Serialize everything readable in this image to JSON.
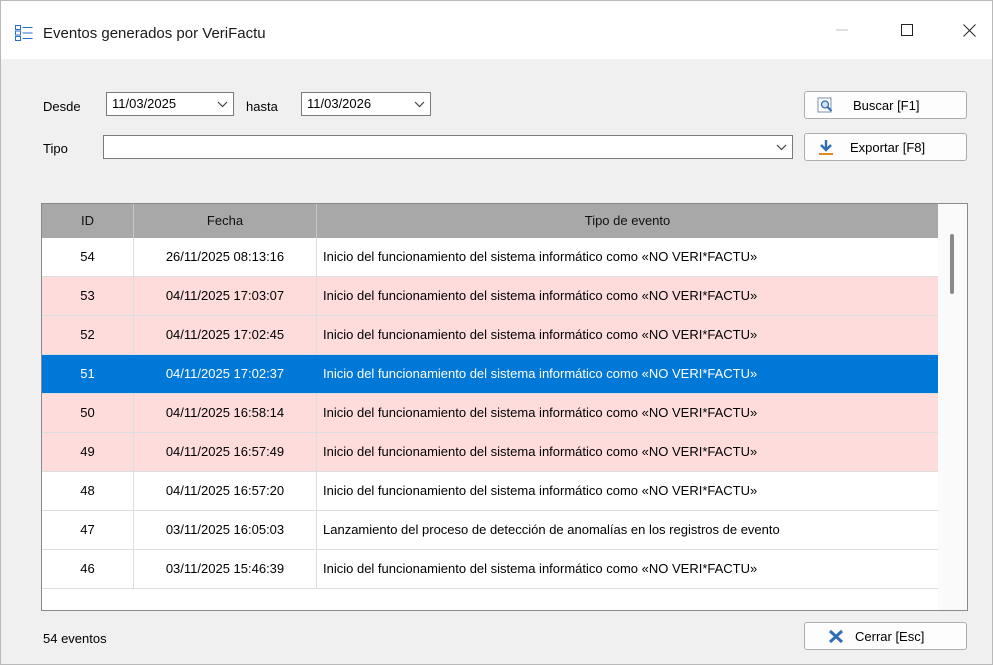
{
  "window": {
    "title": "Eventos generados por VeriFactu",
    "app_icon": "list-view-icon",
    "controls": {
      "minimize_icon": "minimize-icon",
      "maximize_icon": "maximize-icon",
      "close_icon": "close-icon"
    }
  },
  "filters": {
    "desde_label": "Desde",
    "desde_value": "11/03/2025",
    "hasta_label": "hasta",
    "hasta_value": "11/03/2026",
    "tipo_label": "Tipo",
    "tipo_value": ""
  },
  "buttons": {
    "buscar_label": "Buscar [F1]",
    "buscar_icon": "magnifier-icon",
    "exportar_label": "Exportar [F8]",
    "exportar_icon": "download-arrow-icon",
    "cerrar_label": "Cerrar [Esc]",
    "cerrar_icon": "close-x-icon"
  },
  "grid": {
    "columns": [
      "ID",
      "Fecha",
      "Tipo de evento"
    ],
    "rows": [
      {
        "id": "54",
        "fecha": "26/11/2025 08:13:16",
        "tipo": "Inicio del funcionamiento del sistema informático como «NO VERI*FACTU»",
        "style": "normal"
      },
      {
        "id": "53",
        "fecha": "04/11/2025 17:03:07",
        "tipo": "Inicio del funcionamiento del sistema informático como «NO VERI*FACTU»",
        "style": "pink"
      },
      {
        "id": "52",
        "fecha": "04/11/2025 17:02:45",
        "tipo": "Inicio del funcionamiento del sistema informático como «NO VERI*FACTU»",
        "style": "pink"
      },
      {
        "id": "51",
        "fecha": "04/11/2025 17:02:37",
        "tipo": "Inicio del funcionamiento del sistema informático como «NO VERI*FACTU»",
        "style": "sel"
      },
      {
        "id": "50",
        "fecha": "04/11/2025 16:58:14",
        "tipo": "Inicio del funcionamiento del sistema informático como «NO VERI*FACTU»",
        "style": "pink"
      },
      {
        "id": "49",
        "fecha": "04/11/2025 16:57:49",
        "tipo": "Inicio del funcionamiento del sistema informático como «NO VERI*FACTU»",
        "style": "pink"
      },
      {
        "id": "48",
        "fecha": "04/11/2025 16:57:20",
        "tipo": "Inicio del funcionamiento del sistema informático como «NO VERI*FACTU»",
        "style": "normal"
      },
      {
        "id": "47",
        "fecha": "03/11/2025 16:05:03",
        "tipo": "Lanzamiento del proceso de detección de anomalías en los registros de evento",
        "style": "normal"
      },
      {
        "id": "46",
        "fecha": "03/11/2025 15:46:39",
        "tipo": "Inicio del funcionamiento del sistema informático como «NO VERI*FACTU»",
        "style": "normal"
      }
    ]
  },
  "status": {
    "count_text": "54 eventos"
  },
  "colors": {
    "selection": "#0078d7",
    "highlight_row": "#ffdcdc",
    "header": "#a8a8a8"
  }
}
